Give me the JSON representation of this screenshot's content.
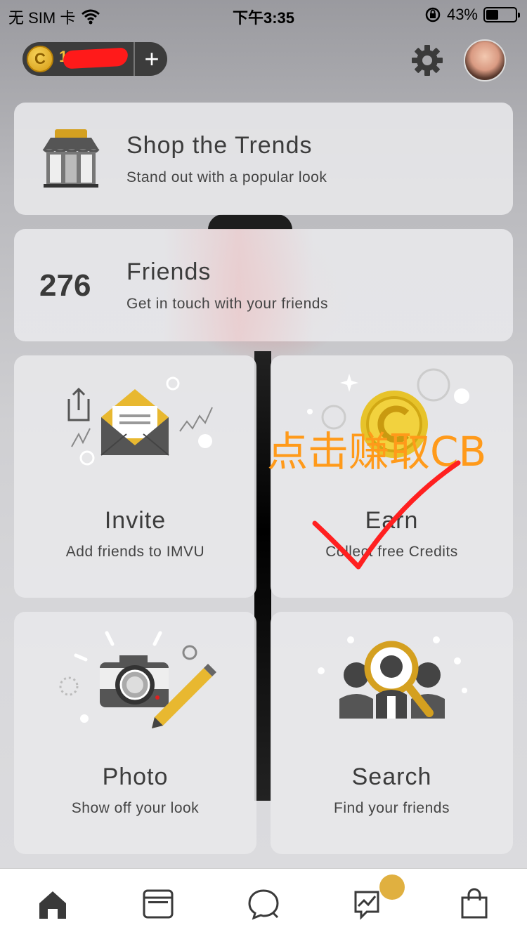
{
  "status_bar": {
    "carrier": "无 SIM 卡",
    "time": "下午3:35",
    "battery": "43%"
  },
  "header": {
    "credits_amount": "1",
    "add_credits_label": "+",
    "coin_symbol": "C"
  },
  "cards": {
    "shop": {
      "title": "Shop the Trends",
      "subtitle": "Stand out with a popular look"
    },
    "friends": {
      "count": "276",
      "title": "Friends",
      "subtitle": "Get in touch with your friends"
    },
    "invite": {
      "title": "Invite",
      "subtitle": "Add friends to IMVU"
    },
    "earn": {
      "title": "Earn",
      "subtitle": "Collect free Credits"
    },
    "photo": {
      "title": "Photo",
      "subtitle": "Show off your look"
    },
    "search": {
      "title": "Search",
      "subtitle": "Find your friends"
    }
  },
  "annotation": {
    "text": "点击赚取CB"
  },
  "nav": {
    "items": [
      "home-icon",
      "feed-icon",
      "chat-icon",
      "activity-icon",
      "shop-bag-icon"
    ],
    "active": "home-icon"
  },
  "colors": {
    "accent_gold": "#e0b040",
    "annotation_orange": "#ff9a1a",
    "annotation_red": "#ff2020"
  }
}
